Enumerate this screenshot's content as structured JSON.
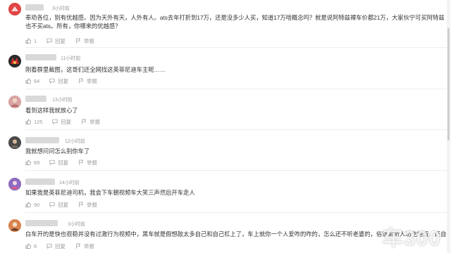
{
  "comments": [
    {
      "time": "3小时前",
      "text": "奉劝各位，别有优越感。因为天外有天，人外有人。ats去年打折到17万，还是没多少人买，知道17万啥概念吗？就是说阿特兹裸车价都21万，大家伙宁可买阿特兹也不买ats。所有，你哪来的优越感？",
      "likes": "1",
      "reply_label": "回复",
      "report_label": "举报"
    },
    {
      "time": "11小时前",
      "text": "刚看群里截图，这哥们还全网找这英菲尼迪车主呢……",
      "likes": "64",
      "reply_label": "回复",
      "report_label": "举报"
    },
    {
      "time": "13小时前",
      "text": "看到这样我就放心了",
      "likes": "125",
      "reply_label": "回复",
      "report_label": "举报"
    },
    {
      "time": "12小时前",
      "text": "我就想问问怎么别你车了",
      "likes": "69",
      "reply_label": "回复",
      "report_label": "举报"
    },
    {
      "time": "14小时前",
      "text": "如果我是英菲尼迪司机，我会下车朝视频车大笑三声然后开车走人",
      "likes": "90",
      "reply_label": "回复",
      "report_label": "举报"
    },
    {
      "time": "3小时前",
      "text": "白车开的是快也很稳并没有过激行为视频中，黑车就是假想敌太多自己和自己杠上了，车上就你一个人爱咋的咋的，怎么还不听老婆的，俗话说听人劝吃饱饭，还自己一意孤行！就",
      "likes": "6",
      "reply_label": "回复",
      "report_label": "举报"
    }
  ],
  "watermark": "车300",
  "colors": {
    "text": "#333333",
    "meta": "#999999",
    "separator": "#eeeeee"
  },
  "icons": {
    "like": "thumbs-up-icon",
    "reply": "chat-bubble-icon",
    "report": "flag-icon"
  }
}
